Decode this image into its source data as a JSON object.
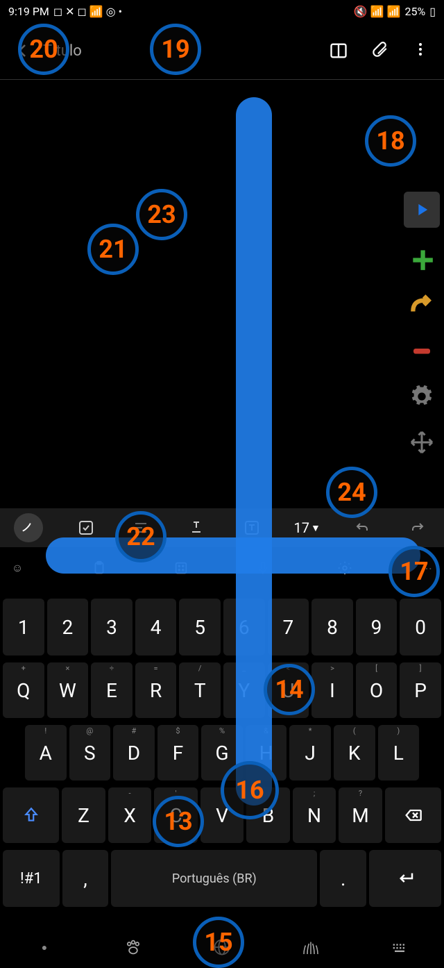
{
  "status": {
    "time": "9:19 PM",
    "battery": "25%"
  },
  "header": {
    "title": "Título"
  },
  "format": {
    "font_size": "17"
  },
  "keyboard": {
    "numbers": [
      "1",
      "2",
      "3",
      "4",
      "5",
      "6",
      "7",
      "8",
      "9",
      "0"
    ],
    "row1": {
      "keys": [
        "Q",
        "W",
        "E",
        "R",
        "T",
        "Y",
        "U",
        "I",
        "O",
        "P"
      ],
      "subs": [
        "+",
        "×",
        "÷",
        "=",
        "/",
        "_",
        "<",
        ">",
        "[",
        "]"
      ]
    },
    "row2": {
      "keys": [
        "A",
        "S",
        "D",
        "F",
        "G",
        "H",
        "J",
        "K",
        "L"
      ],
      "subs": [
        "!",
        "@",
        "#",
        "$",
        "%",
        "&",
        "*",
        "(",
        ")"
      ]
    },
    "row3": {
      "keys": [
        "Z",
        "X",
        "C",
        "V",
        "B",
        "N",
        "M"
      ],
      "subs": [
        "",
        "-",
        "'",
        "\"",
        ":",
        ";",
        "?"
      ]
    },
    "sym": "!#1",
    "comma": ",",
    "space": "Português (BR)",
    "period": "."
  },
  "circles": {
    "c13": "13",
    "c14": "14",
    "c15": "15",
    "c16": "16",
    "c17": "17",
    "c18": "18",
    "c19": "19",
    "c20": "20",
    "c21": "21",
    "c22": "22",
    "c23": "23",
    "c24": "24"
  }
}
